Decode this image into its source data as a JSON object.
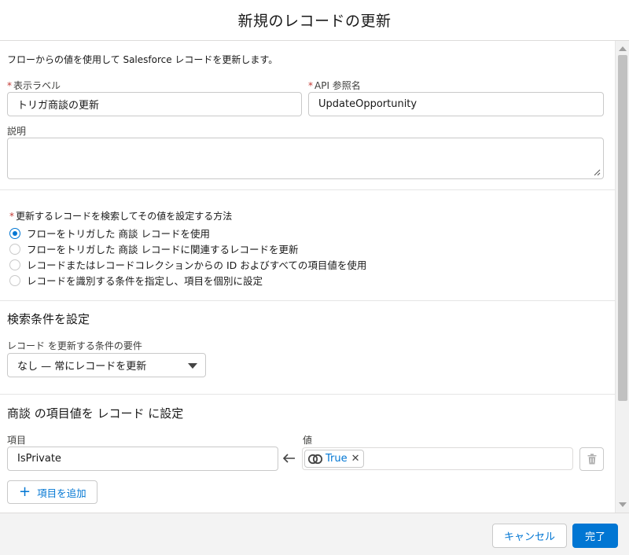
{
  "header": {
    "title": "新規のレコードの更新"
  },
  "intro": "フローからの値を使用して Salesforce レコードを更新します。",
  "required_marker": "*",
  "fields": {
    "label": {
      "label": "表示ラベル",
      "value": "トリガ商談の更新"
    },
    "api_name": {
      "label": "API 参照名",
      "value": "UpdateOpportunity"
    },
    "description": {
      "label": "説明",
      "value": ""
    }
  },
  "method": {
    "label": "更新するレコードを検索してその値を設定する方法",
    "options": [
      {
        "label": "フローをトリガした 商談 レコードを使用",
        "selected": true
      },
      {
        "label": "フローをトリガした 商談 レコードに関連するレコードを更新",
        "selected": false
      },
      {
        "label": "レコードまたはレコードコレクションからの ID およびすべての項目値を使用",
        "selected": false
      },
      {
        "label": "レコードを識別する条件を指定し、項目を個別に設定",
        "selected": false
      }
    ]
  },
  "filter": {
    "title": "検索条件を設定",
    "condition_label": "レコード を更新する条件の要件",
    "condition_value": "なし — 常にレコードを更新"
  },
  "assign": {
    "title": "商談 の項目値を レコード に設定",
    "field_label": "項目",
    "value_label": "値",
    "rows": [
      {
        "field": "IsPrivate",
        "value": "True"
      }
    ],
    "add_label": "項目を追加"
  },
  "footer": {
    "cancel": "キャンセル",
    "done": "完了"
  },
  "colors": {
    "brand": "#0176d3",
    "required": "#c23934"
  },
  "icons": [
    "arrow-left-icon",
    "boolean-icon",
    "close-icon",
    "trash-icon",
    "plus-icon",
    "chevron-down-icon",
    "resize-grip-icon"
  ]
}
